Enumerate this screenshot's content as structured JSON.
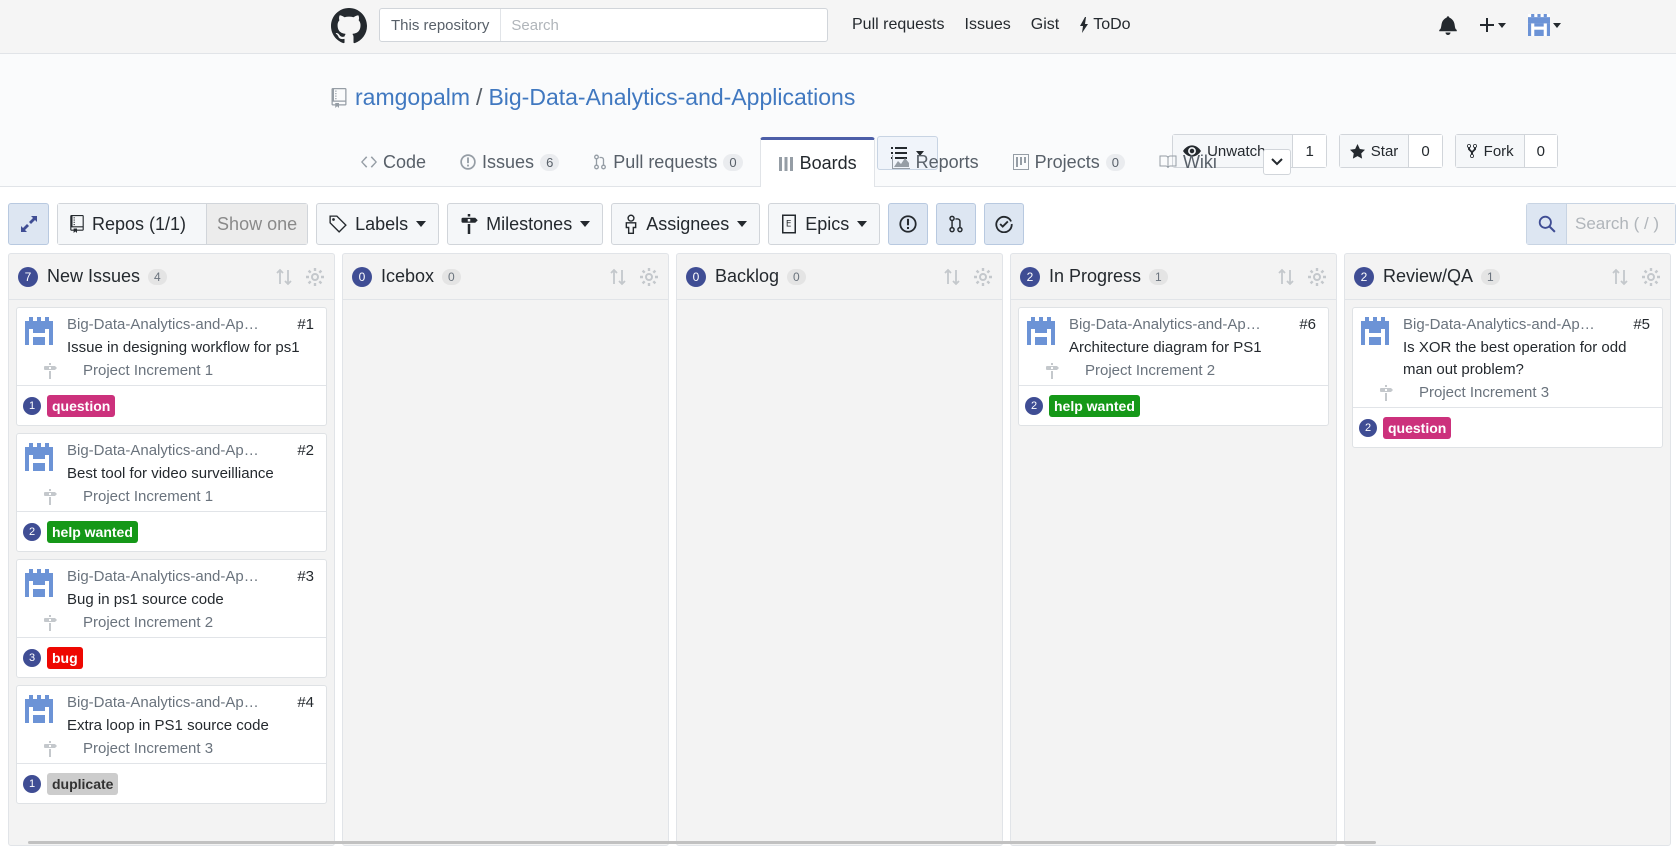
{
  "topbar": {
    "search_scope": "This repository",
    "search_placeholder": "Search",
    "nav": [
      "Pull requests",
      "Issues",
      "Gist",
      "ToDo"
    ]
  },
  "repo": {
    "owner": "ramgopalm",
    "separator": "/",
    "name": "Big-Data-Analytics-and-Applications",
    "watch_label": "Unwatch",
    "watch_count": "1",
    "star_label": "Star",
    "star_count": "0",
    "fork_label": "Fork",
    "fork_count": "0"
  },
  "tabs": [
    {
      "label": "Code",
      "count": null
    },
    {
      "label": "Issues",
      "count": "6"
    },
    {
      "label": "Pull requests",
      "count": "0"
    },
    {
      "label": "Boards",
      "count": null,
      "selected": true
    },
    {
      "label": "Reports",
      "count": null
    },
    {
      "label": "Projects",
      "count": "0"
    },
    {
      "label": "Wiki",
      "count": null
    }
  ],
  "toolbar": {
    "repos_label": "Repos (1/1)",
    "show_one_label": "Show one",
    "labels_label": "Labels",
    "milestones_label": "Milestones",
    "assignees_label": "Assignees",
    "epics_label": "Epics",
    "search_placeholder": "Search ( / )"
  },
  "colors": {
    "accent": "#3f4d94",
    "link": "#4078c0",
    "question": "#cc317c",
    "help_wanted": "#159818",
    "bug": "#ee0701",
    "duplicate": "#cccccc"
  },
  "columns": [
    {
      "index": "7",
      "title": "New Issues",
      "count": "4",
      "cards": [
        {
          "repo": "Big-Data-Analytics-and-Applications",
          "number": "#1",
          "title": "Issue in designing workflow for ps1",
          "milestone": "Project Increment 1",
          "points": "1",
          "label": "question",
          "label_class": "question"
        },
        {
          "repo": "Big-Data-Analytics-and-Applications",
          "number": "#2",
          "title": "Best tool for video surveilliance",
          "milestone": "Project Increment 1",
          "points": "2",
          "label": "help wanted",
          "label_class": "help"
        },
        {
          "repo": "Big-Data-Analytics-and-Applications",
          "number": "#3",
          "title": "Bug in ps1 source code",
          "milestone": "Project Increment 2",
          "points": "3",
          "label": "bug",
          "label_class": "bug"
        },
        {
          "repo": "Big-Data-Analytics-and-Applications",
          "number": "#4",
          "title": "Extra loop in PS1 source code",
          "milestone": "Project Increment 3",
          "points": "1",
          "label": "duplicate",
          "label_class": "duplicate"
        }
      ]
    },
    {
      "index": "0",
      "title": "Icebox",
      "count": "0",
      "cards": []
    },
    {
      "index": "0",
      "title": "Backlog",
      "count": "0",
      "cards": []
    },
    {
      "index": "2",
      "title": "In Progress",
      "count": "1",
      "cards": [
        {
          "repo": "Big-Data-Analytics-and-Applications",
          "number": "#6",
          "title": "Architecture diagram for PS1",
          "milestone": "Project Increment 2",
          "points": "2",
          "label": "help wanted",
          "label_class": "help"
        }
      ]
    },
    {
      "index": "2",
      "title": "Review/QA",
      "count": "1",
      "cards": [
        {
          "repo": "Big-Data-Analytics-and-Applications",
          "number": "#5",
          "title": "Is XOR the best operation for odd man out problem?",
          "milestone": "Project Increment 3",
          "points": "2",
          "label": "question",
          "label_class": "question"
        }
      ]
    }
  ]
}
